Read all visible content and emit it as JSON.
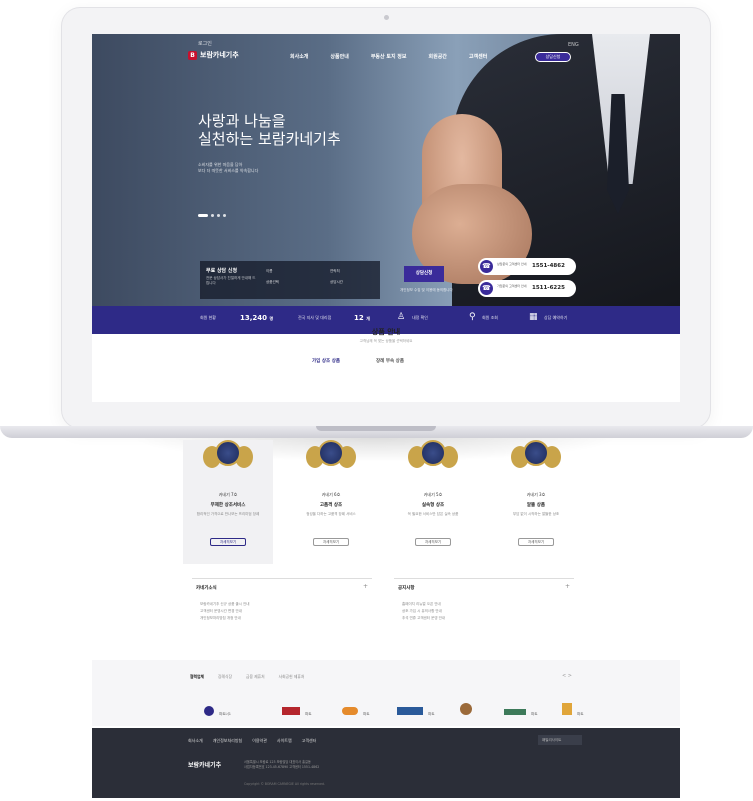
{
  "header": {
    "top_small": "로그인",
    "logo_text": "보람카네기추",
    "nav": [
      "회사소개",
      "상품안내",
      "부동산 토지 정보",
      "회원공간",
      "고객센터"
    ],
    "top_right": "ENG",
    "cta": "상담신청"
  },
  "hero": {
    "title_line1": "사랑과 나눔을",
    "title_line2": "실천하는 보람카네기추",
    "sub_line1": "소비자를 위한 마음을 담아",
    "sub_line2": "보다 더 따뜻한 서비스를 약속합니다"
  },
  "consult": {
    "title": "무료 상담 신청",
    "desc": "전문 상담사가 친절하게 안내해 드립니다",
    "field_name": "이름",
    "field_phone": "연락처",
    "field_product": "상품선택",
    "field_time": "상담시간",
    "apply": "상담신청",
    "agree": "개인정보 수집 및 이용에 동의합니다"
  },
  "phones": [
    {
      "label": "상담문의 고객센터 안내",
      "number": "1551-4862"
    },
    {
      "label": "가입문의 고객센터 안내",
      "number": "1511-6225"
    }
  ],
  "stats": {
    "members_label": "회원 현황",
    "members_value": "13,240",
    "members_unit": "명",
    "branches_label": "전국 지사 및 대리점",
    "branches_value": "12",
    "branches_unit": "개",
    "link1": "내정 확인",
    "link2": "회원 조회",
    "link3": "상담 예약하기"
  },
  "section": {
    "title": "상품 안내",
    "subtitle": "고객님께 꼭 맞는 상품을 선택하세요",
    "tab_active": "가입 상조 상품",
    "tab_inactive": "장례 부속 상품"
  },
  "products": [
    {
      "label": "카네기 7호",
      "title": "무제한 상조서비스",
      "desc": "합리적인 가격으로 만나보는 프리미엄 장례",
      "btn": "자세히보기"
    },
    {
      "label": "카네기 6호",
      "title": "고품격 상조",
      "desc": "정성을 다하는 고품격 장례 서비스",
      "btn": "자세히보기"
    },
    {
      "label": "카네기 5호",
      "title": "실속형 상조",
      "desc": "꼭 필요한 서비스만 담은 실속 상품",
      "btn": "자세히보기"
    },
    {
      "label": "카네기 3호",
      "title": "알뜰 상품",
      "desc": "부담 없이 시작하는 알뜰한 상조",
      "btn": "자세히보기"
    }
  ],
  "notices": [
    {
      "title": "카네기소식",
      "items": [
        "보람카네기추 신규 상품 출시 안내",
        "고객센터 운영시간 변경 안내",
        "개인정보처리방침 개정 안내"
      ]
    },
    {
      "title": "공지사항",
      "items": [
        "홈페이지 리뉴얼 오픈 안내",
        "상조 가입 시 유의사항 안내",
        "추석 연휴 고객센터 운영 안내"
      ]
    }
  ],
  "partners": {
    "tabs": [
      "협력업체",
      "장례식장",
      "금융 제휴처",
      "사회공헌 제휴처"
    ],
    "nav": "< >",
    "logos": [
      "파트너1",
      "파트너2",
      "파트너3",
      "파트너4",
      "파트너5",
      "파트너6",
      "파트너7"
    ]
  },
  "footer": {
    "links": [
      "회사소개",
      "개인정보처리방침",
      "이용약관",
      "사이트맵",
      "고객센터"
    ],
    "select": "패밀리사이트",
    "logo": "보람카네기추",
    "info_line1": "서울특별시 보람로 123 보람빌딩 대표이사 홍길동",
    "info_line2": "사업자등록번호 123-45-67890 고객센터 1551-4862",
    "copyright": "Copyright © BORAM CARNEGIE All rights reserved."
  },
  "colors": {
    "brand": "#2e2a87",
    "logo_red": "#c8102e",
    "footer_bg": "#2b2e38"
  }
}
